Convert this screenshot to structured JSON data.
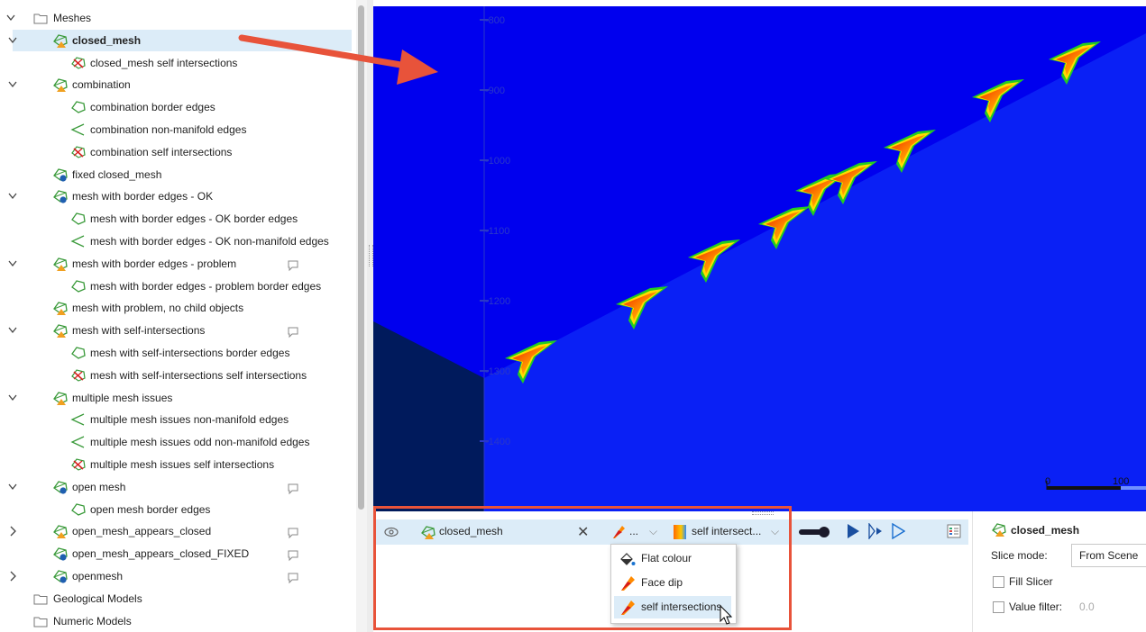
{
  "tree": {
    "items": [
      {
        "label": "Meshes",
        "indent": 0,
        "chevron": "open",
        "icon": "folder-icon",
        "comment": false,
        "selected": false,
        "bold": false
      },
      {
        "label": "closed_mesh",
        "indent": 1,
        "chevron": "open",
        "icon": "mesh-warning-icon",
        "comment": false,
        "selected": true,
        "bold": true
      },
      {
        "label": "closed_mesh self intersections",
        "indent": 2,
        "chevron": "none",
        "icon": "self-intersections-icon",
        "comment": false,
        "selected": false,
        "bold": false
      },
      {
        "label": "combination",
        "indent": 1,
        "chevron": "open",
        "icon": "mesh-warning-icon",
        "comment": false,
        "selected": false,
        "bold": false
      },
      {
        "label": "combination border edges",
        "indent": 2,
        "chevron": "none",
        "icon": "border-edges-icon",
        "comment": false,
        "selected": false,
        "bold": false
      },
      {
        "label": "combination non-manifold edges",
        "indent": 2,
        "chevron": "none",
        "icon": "non-manifold-edges-icon",
        "comment": false,
        "selected": false,
        "bold": false
      },
      {
        "label": "combination self intersections",
        "indent": 2,
        "chevron": "none",
        "icon": "self-intersections-icon",
        "comment": false,
        "selected": false,
        "bold": false
      },
      {
        "label": "fixed closed_mesh",
        "indent": 1,
        "chevron": "none",
        "icon": "mesh-info-icon",
        "comment": false,
        "selected": false,
        "bold": false
      },
      {
        "label": "mesh with border edges - OK",
        "indent": 1,
        "chevron": "open",
        "icon": "mesh-info-icon",
        "comment": false,
        "selected": false,
        "bold": false
      },
      {
        "label": "mesh with border edges - OK border edges",
        "indent": 2,
        "chevron": "none",
        "icon": "border-edges-icon",
        "comment": false,
        "selected": false,
        "bold": false
      },
      {
        "label": "mesh with border edges - OK non-manifold edges",
        "indent": 2,
        "chevron": "none",
        "icon": "non-manifold-edges-icon",
        "comment": false,
        "selected": false,
        "bold": false
      },
      {
        "label": "mesh with border edges - problem",
        "indent": 1,
        "chevron": "open",
        "icon": "mesh-warning-icon",
        "comment": true,
        "selected": false,
        "bold": false
      },
      {
        "label": "mesh with border edges - problem border edges",
        "indent": 2,
        "chevron": "none",
        "icon": "border-edges-icon",
        "comment": false,
        "selected": false,
        "bold": false
      },
      {
        "label": "mesh with problem, no child objects",
        "indent": 1,
        "chevron": "none",
        "icon": "mesh-warning-icon",
        "comment": false,
        "selected": false,
        "bold": false
      },
      {
        "label": "mesh with self-intersections",
        "indent": 1,
        "chevron": "open",
        "icon": "mesh-warning-icon",
        "comment": true,
        "selected": false,
        "bold": false
      },
      {
        "label": "mesh with self-intersections border edges",
        "indent": 2,
        "chevron": "none",
        "icon": "border-edges-icon",
        "comment": false,
        "selected": false,
        "bold": false
      },
      {
        "label": "mesh with self-intersections self intersections",
        "indent": 2,
        "chevron": "none",
        "icon": "self-intersections-icon",
        "comment": false,
        "selected": false,
        "bold": false
      },
      {
        "label": "multiple mesh issues",
        "indent": 1,
        "chevron": "open",
        "icon": "mesh-warning-icon",
        "comment": false,
        "selected": false,
        "bold": false
      },
      {
        "label": "multiple mesh issues non-manifold edges",
        "indent": 2,
        "chevron": "none",
        "icon": "non-manifold-edges-icon",
        "comment": false,
        "selected": false,
        "bold": false
      },
      {
        "label": "multiple mesh issues odd non-manifold edges",
        "indent": 2,
        "chevron": "none",
        "icon": "non-manifold-edges-icon",
        "comment": false,
        "selected": false,
        "bold": false
      },
      {
        "label": "multiple mesh issues self intersections",
        "indent": 2,
        "chevron": "none",
        "icon": "self-intersections-icon",
        "comment": false,
        "selected": false,
        "bold": false
      },
      {
        "label": "open mesh",
        "indent": 1,
        "chevron": "open",
        "icon": "mesh-info-icon",
        "comment": true,
        "selected": false,
        "bold": false
      },
      {
        "label": "open mesh border edges",
        "indent": 2,
        "chevron": "none",
        "icon": "border-edges-icon",
        "comment": false,
        "selected": false,
        "bold": false
      },
      {
        "label": "open_mesh_appears_closed",
        "indent": 1,
        "chevron": "closed",
        "icon": "mesh-warning-icon",
        "comment": true,
        "selected": false,
        "bold": false
      },
      {
        "label": "open_mesh_appears_closed_FIXED",
        "indent": 1,
        "chevron": "none",
        "icon": "mesh-info-icon",
        "comment": true,
        "selected": false,
        "bold": false
      },
      {
        "label": "openmesh",
        "indent": 1,
        "chevron": "closed",
        "icon": "mesh-info-icon",
        "comment": true,
        "selected": false,
        "bold": false
      },
      {
        "label": "Geological Models",
        "indent": 0,
        "chevron": "none",
        "icon": "folder-icon",
        "comment": false,
        "selected": false,
        "bold": false
      },
      {
        "label": "Numeric Models",
        "indent": 0,
        "chevron": "none",
        "icon": "folder-icon",
        "comment": false,
        "selected": false,
        "bold": false
      }
    ]
  },
  "scene": {
    "depth_labels": [
      "-800",
      "-900",
      "-1000",
      "-1100",
      "-1200",
      "-1300",
      "-1400"
    ],
    "scale_bar": {
      "start": "0",
      "end": "100"
    },
    "colors": {
      "background": "#0000ee",
      "surface": "#0a20f5",
      "dark_region": "#001a5c",
      "axis": "#2a38c8",
      "hot": "#ee2200",
      "mid": "#ff8800",
      "warm": "#ffdd00",
      "cool": "#22cc22"
    }
  },
  "layer": {
    "name": "closed_mesh",
    "colour_mode_short": "...",
    "colour_mode": "self intersect...",
    "menu": [
      {
        "label": "Flat colour",
        "icon": "paint-bucket-icon",
        "highlighted": false
      },
      {
        "label": "Face dip",
        "icon": "face-dip-icon",
        "highlighted": false
      },
      {
        "label": "self intersections",
        "icon": "face-dip-icon",
        "highlighted": true
      }
    ]
  },
  "properties": {
    "title": "closed_mesh",
    "slice_mode_label": "Slice mode:",
    "slice_mode_value": "From Scene",
    "fill_slicer_label": "Fill Slicer",
    "value_filter_label": "Value filter:",
    "value_filter_placeholder": "0.0"
  },
  "annotation": {
    "arrow_color": "#e8533a",
    "box_color": "#e8533a"
  }
}
